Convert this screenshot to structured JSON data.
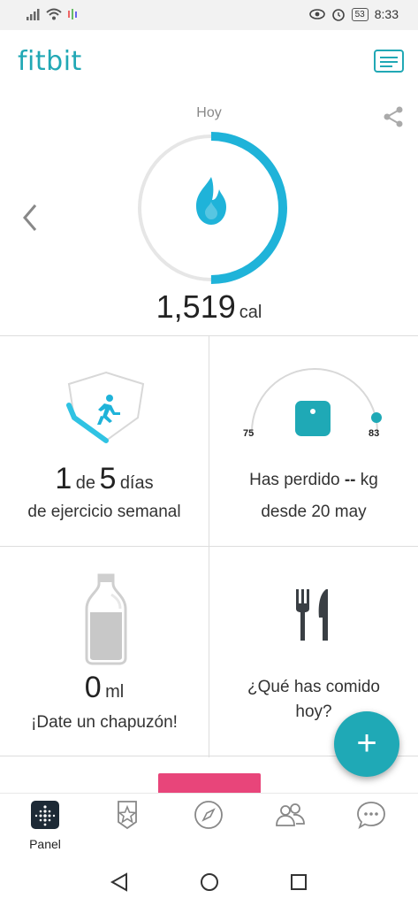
{
  "status_bar": {
    "battery": "53",
    "time": "8:33"
  },
  "app": {
    "logo": "fitbit"
  },
  "hero": {
    "date_label": "Hoy",
    "calories_value": "1,519",
    "calories_unit": "cal",
    "progress": 0.5
  },
  "tiles": {
    "exercise": {
      "count": "1",
      "of_word": "de",
      "goal": "5",
      "days_word": "días",
      "label": "de ejercicio semanal"
    },
    "weight": {
      "start": "75",
      "goal": "83",
      "line1_prefix": "Has perdido",
      "line1_value": "--",
      "line1_unit": "kg",
      "line2": "desde 20 may"
    },
    "water": {
      "value": "0",
      "unit": "ml",
      "label": "¡Date un chapuzón!"
    },
    "food": {
      "line1": "¿Qué has comido",
      "line2": "hoy?"
    }
  },
  "fab": {
    "label": "+"
  },
  "bottom_nav": {
    "items": [
      {
        "label": "Panel"
      },
      {
        "label": ""
      },
      {
        "label": ""
      },
      {
        "label": ""
      },
      {
        "label": ""
      }
    ]
  },
  "colors": {
    "accent": "#21a8b5",
    "pink": "#e8457a"
  }
}
